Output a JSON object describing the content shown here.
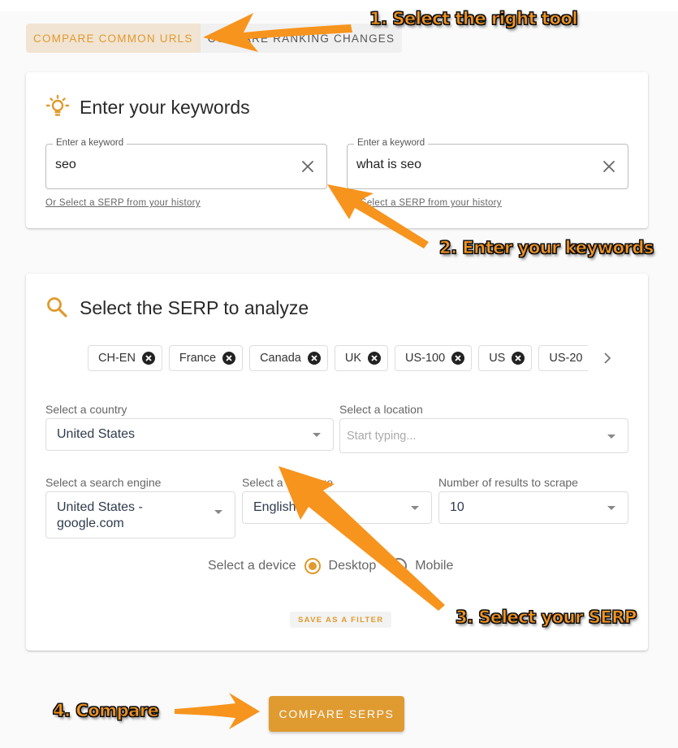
{
  "tabs": [
    {
      "label": "COMPARE COMMON URLS",
      "active": true
    },
    {
      "label": "COMPARE RANKING CHANGES",
      "active": false
    }
  ],
  "keywords_card": {
    "title": "Enter your keywords",
    "icon": "lightbulb-icon",
    "fields": [
      {
        "legend": "Enter a keyword",
        "value": "seo",
        "history_link": "Or Select a SERP from your history"
      },
      {
        "legend": "Enter a keyword",
        "value": "what is seo",
        "history_link": "Or Select a SERP from your history"
      }
    ]
  },
  "serp_card": {
    "title": "Select the SERP to analyze",
    "icon": "search-icon",
    "saved_filters": [
      "CH-EN",
      "France",
      "Canada",
      "UK",
      "US-100",
      "US",
      "US-20"
    ],
    "country": {
      "label": "Select a country",
      "value": "United States"
    },
    "location": {
      "label": "Select a location",
      "placeholder": "Start typing..."
    },
    "search_engine": {
      "label": "Select a search engine",
      "value": "United States - google.com"
    },
    "language": {
      "label": "Select a language",
      "value": "English"
    },
    "results": {
      "label": "Number of results to scrape",
      "value": "10"
    },
    "device": {
      "label": "Select a device",
      "options": [
        {
          "label": "Desktop",
          "checked": true
        },
        {
          "label": "Mobile",
          "checked": false
        }
      ]
    },
    "save_filter_label": "SAVE AS A FILTER"
  },
  "compare_button_label": "COMPARE SERPS",
  "annotations": [
    "1. Select the right tool",
    "2. Enter your keywords",
    "3. Select your SERP",
    "4. Compare"
  ],
  "colors": {
    "accent": "#e09a2e",
    "annotation": "#f7941d",
    "tab_active_bg": "#f2e4d3"
  }
}
